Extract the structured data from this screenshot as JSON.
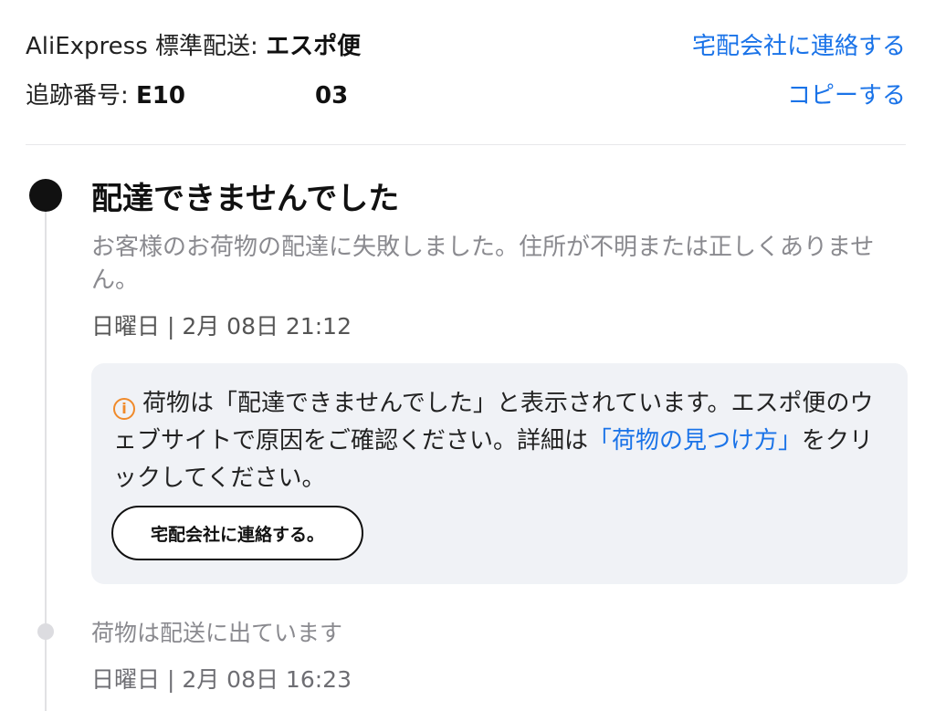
{
  "shipping": {
    "label": "AliExpress 標準配送: ",
    "carrier": "エスポ便",
    "contact_link": "宅配会社に連絡する"
  },
  "tracking": {
    "label": "追跡番号: ",
    "prefix": "E10",
    "suffix": "03",
    "copy_link": "コピーする"
  },
  "events": [
    {
      "title": "配達できませんでした",
      "description": "お客様のお荷物の配達に失敗しました。住所が不明または正しくありません。",
      "date": "日曜日 | 2月 08日 21:12"
    },
    {
      "title": "荷物は配送に出ています",
      "date": "日曜日 | 2月 08日 16:23"
    }
  ],
  "notice": {
    "icon": "info-icon",
    "text_before": "荷物は「配達できませんでした」と表示されています。エスポ便のウェブサイトで原因をご確認ください。詳細は",
    "link": "「荷物の見つけ方」",
    "text_after": "をクリックしてください。",
    "button": "宅配会社に連絡する。"
  },
  "colors": {
    "link": "#1a73e8",
    "info_icon": "#f08a2a",
    "notice_bg": "#f0f2f6",
    "active_dot": "#111111",
    "inactive_dot": "#dcdce0"
  }
}
